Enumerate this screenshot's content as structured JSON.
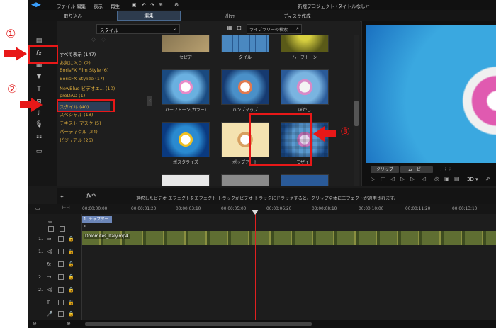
{
  "menu": {
    "file": "ファイル",
    "edit": "編集",
    "view": "表示",
    "play": "再生"
  },
  "title": "新規プロジェクト (タイトルなし)*",
  "modes": {
    "import": "取り込み",
    "edit": "編集",
    "output": "出力",
    "disc": "ディスク作成"
  },
  "library": {
    "style_dropdown": "スタイル",
    "search_placeholder": "ライブラリーの検索",
    "categories": [
      "すべて表示 (147)",
      "お気に入り (2)",
      "BorisFX Film Style (6)",
      "BorisFX Stylize (17)",
      "NewBlue ビデオエ... (10)",
      "proDAD (1)",
      "スタイル (40)",
      "スペシャル (18)",
      "テキスト マスク (5)",
      "パーティクル (24)",
      "ビジュアル (26)"
    ],
    "effects_row1": [
      "セピア",
      "タイル",
      "ハーフトーン"
    ],
    "effects_row2": [
      "ハーフトーン(カラー)",
      "バンプマップ",
      "ぼかし"
    ],
    "effects_row3": [
      "ポスタライズ",
      "ポップアート",
      "モザイク"
    ]
  },
  "preview": {
    "clip_btn": "クリップ",
    "movie_btn": "ムービー",
    "timecode": "--;--;--;--",
    "mode3d": "3D ▾"
  },
  "timeline": {
    "hint": "選択したビデオ エフェクトをエフェクト トラックかビデオ トラックにドラッグすると、クリップ全体にエフェクトが適用されます。",
    "ruler": [
      "00;00;00;00",
      "00;00;01;20",
      "00;00;03;10",
      "00;00;05;00",
      "00;00;06;20",
      "00;00;08;10",
      "00;00;10;00",
      "00;00;11;20",
      "00;00;13;10"
    ],
    "chapter": "1. チャプター 1",
    "clip_label": "Dolomites_Italy.mp4",
    "tracks": [
      "1.",
      "1.",
      "fx",
      "2.",
      "2.",
      "T",
      "🎤",
      "♪"
    ]
  },
  "annotations": {
    "one": "①",
    "two": "②",
    "three": "③"
  },
  "colors": {
    "accent": "#e81818",
    "category": "#d7a83c"
  }
}
